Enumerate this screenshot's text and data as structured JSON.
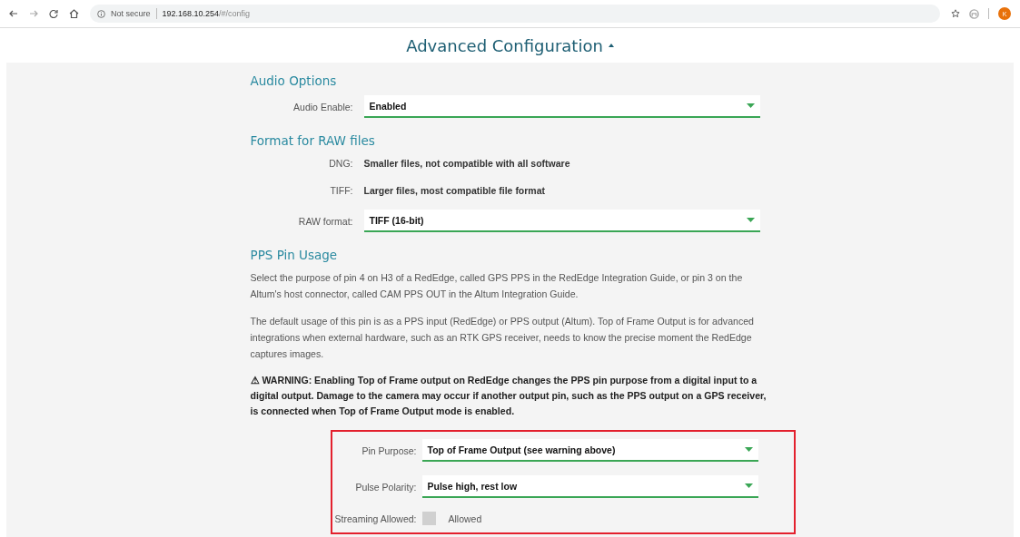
{
  "browser": {
    "security": "Not secure",
    "host": "192.168.10.254",
    "path": "/#/config",
    "avatar": "K"
  },
  "page": {
    "title": "Advanced Configuration"
  },
  "sections": [
    {
      "title": "Audio Options",
      "items": [
        {
          "kind": "select",
          "label": "Audio Enable:",
          "value": "Enabled",
          "highlighted": false
        }
      ]
    },
    {
      "title": "Format for RAW files",
      "items": [
        {
          "kind": "info",
          "label": "DNG:",
          "value": "Smaller files, not compatible with all software",
          "highlighted": false
        },
        {
          "kind": "info",
          "label": "TIFF:",
          "value": "Larger files, most compatible file format",
          "highlighted": false
        },
        {
          "kind": "select",
          "label": "RAW format:",
          "value": "TIFF (16-bit)",
          "highlighted": false
        }
      ]
    },
    {
      "title": "PPS Pin Usage",
      "items": [
        {
          "kind": "paragraph",
          "text": "Select the purpose of pin 4 on H3 of a RedEdge, called GPS PPS in the RedEdge Integration Guide, or pin 3 on the Altum's host connector, called CAM PPS OUT in the Altum Integration Guide.",
          "highlighted": false
        },
        {
          "kind": "paragraph",
          "text": "The default usage of this pin is as a PPS input (RedEdge) or PPS output (Altum). Top of Frame Output is for advanced integrations when external hardware, such as an RTK GPS receiver, needs to know the precise moment the RedEdge captures images.",
          "highlighted": false
        },
        {
          "kind": "warning",
          "text": "⚠ WARNING: Enabling Top of Frame output on RedEdge changes the PPS pin purpose from a digital input to a digital output. Damage to the camera may occur if another output pin, such as the PPS output on a GPS receiver, is connected when Top of Frame Output mode is enabled.",
          "highlighted": false
        },
        {
          "kind": "select",
          "label": "Pin Purpose:",
          "value": "Top of Frame Output (see warning above)",
          "highlighted": true
        },
        {
          "kind": "select",
          "label": "Pulse Polarity:",
          "value": "Pulse high, rest low",
          "highlighted": true
        },
        {
          "kind": "checkbox",
          "label": "Streaming Allowed:",
          "option": "Allowed",
          "checked": false,
          "highlighted": true
        }
      ]
    }
  ]
}
